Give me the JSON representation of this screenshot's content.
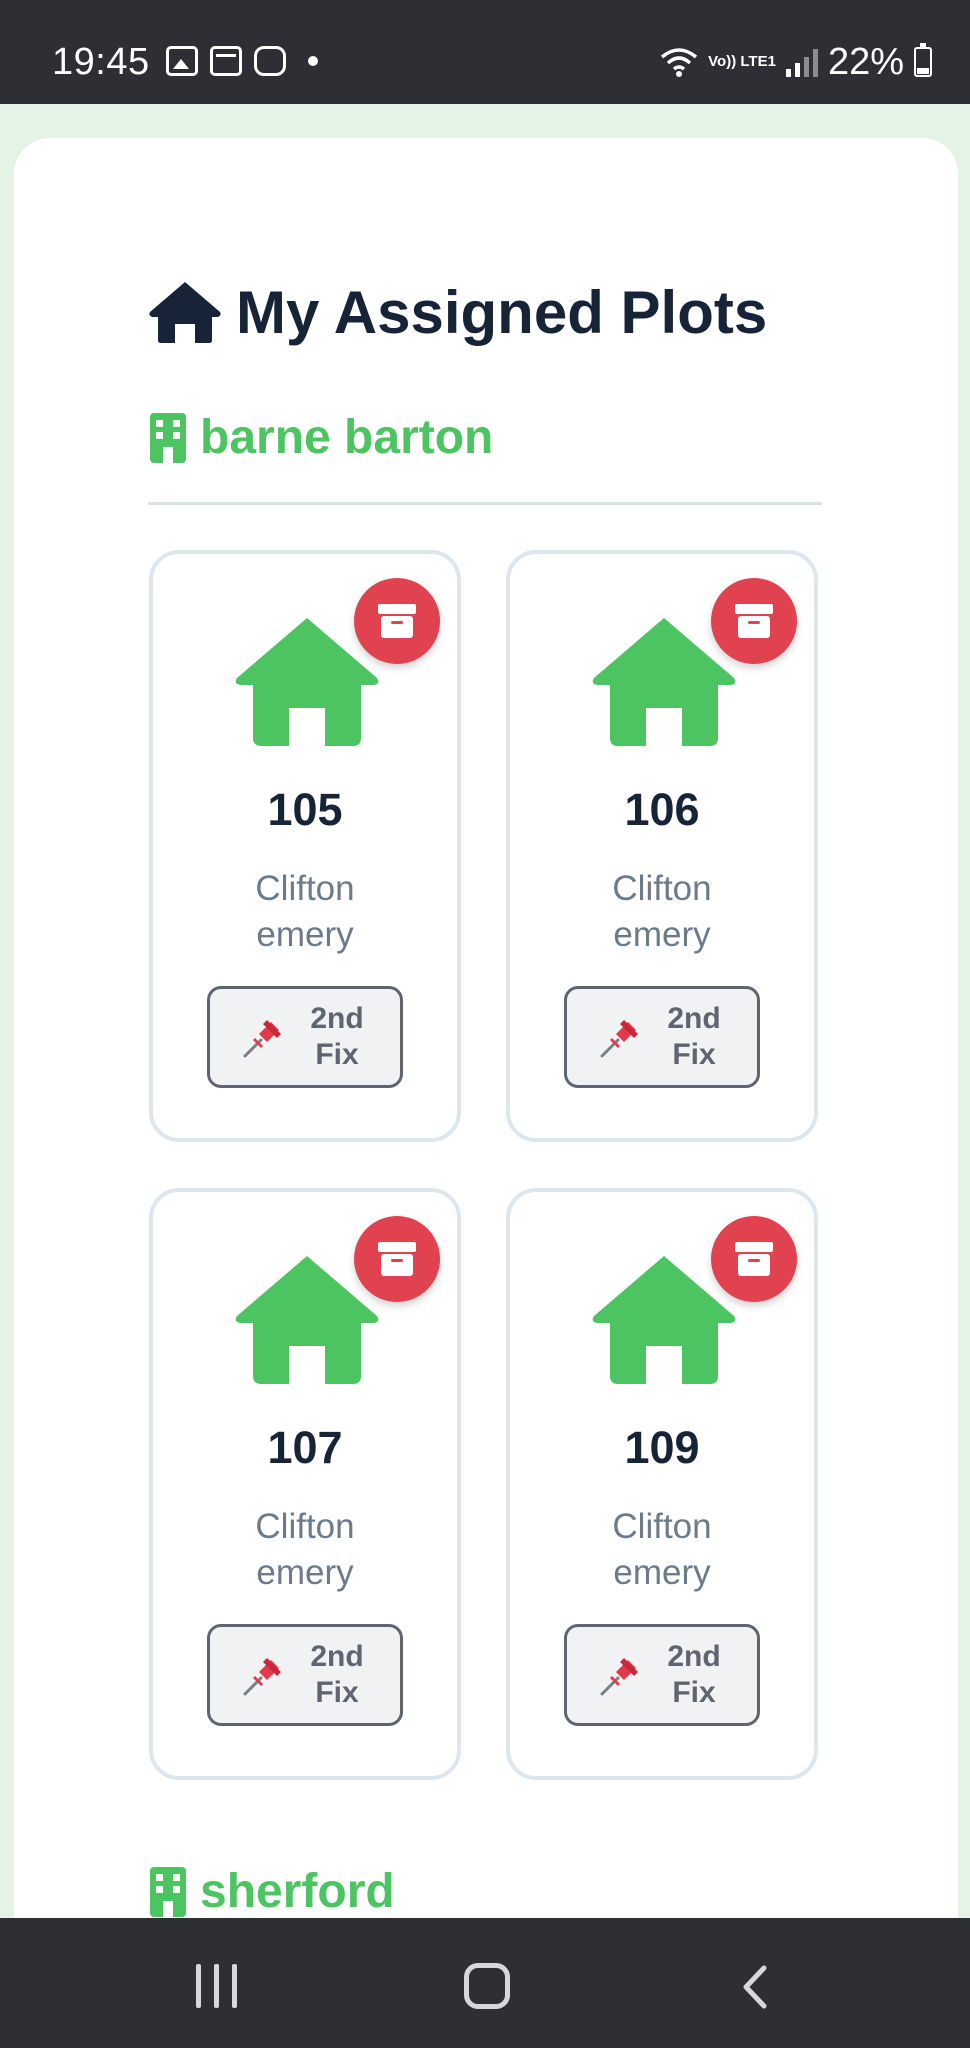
{
  "status_bar": {
    "time": "19:45",
    "network_label": "Vo)) LTE1",
    "battery": "22%",
    "battery_level": 0.22
  },
  "page": {
    "title": "My Assigned Plots",
    "title_icon": "home-icon"
  },
  "sites": [
    {
      "name": "barne barton",
      "icon": "building-icon",
      "plots": [
        {
          "number": "105",
          "client_line1": "Clifton",
          "client_line2": "emery",
          "stage_line1": "2nd",
          "stage_line2": "Fix"
        },
        {
          "number": "106",
          "client_line1": "Clifton",
          "client_line2": "emery",
          "stage_line1": "2nd",
          "stage_line2": "Fix"
        },
        {
          "number": "107",
          "client_line1": "Clifton",
          "client_line2": "emery",
          "stage_line1": "2nd",
          "stage_line2": "Fix"
        },
        {
          "number": "109",
          "client_line1": "Clifton",
          "client_line2": "emery",
          "stage_line1": "2nd",
          "stage_line2": "Fix"
        }
      ]
    },
    {
      "name": "sherford",
      "icon": "building-icon",
      "plots": []
    }
  ],
  "colors": {
    "accent_green": "#4dc462",
    "archive_red": "#e0424f",
    "title_dark": "#172336",
    "muted_text": "#6c7a8a"
  }
}
